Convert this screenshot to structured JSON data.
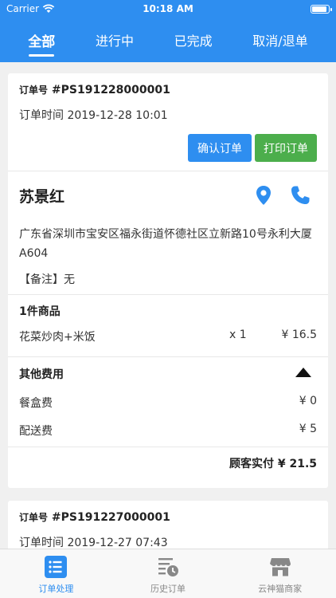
{
  "status_bar": {
    "carrier": "Carrier",
    "time": "10:18 AM",
    "battery_level": 0.95
  },
  "tabs": [
    {
      "label": "全部",
      "active": true
    },
    {
      "label": "进行中",
      "active": false
    },
    {
      "label": "已完成",
      "active": false
    },
    {
      "label": "取消/退单",
      "active": false
    }
  ],
  "orders": [
    {
      "order_no_label": "订单号",
      "order_no": "#PS191228000001",
      "time": "订单时间 2019-12-28 10:01",
      "confirm_label": "确认订单",
      "print_label": "打印订单",
      "customer_name": "苏景红",
      "address": "广东省深圳市宝安区福永街道怀德社区立新路10号永利大厦A604",
      "remark": "【备注】无",
      "goods_title": "1件商品",
      "goods": [
        {
          "name": "花菜炒肉+米饭",
          "qty": "x 1",
          "price": "¥ 16.5"
        }
      ],
      "fees_title": "其他费用",
      "fees": [
        {
          "name": "餐盒费",
          "amount": "¥ 0"
        },
        {
          "name": "配送费",
          "amount": "¥ 5"
        }
      ],
      "total": "顾客实付 ¥ 21.5"
    },
    {
      "order_no_label": "订单号",
      "order_no": "#PS191227000001",
      "time": "订单时间 2019-12-27 07:43"
    }
  ],
  "tabbar": [
    {
      "label": "订单处理",
      "icon": "list-icon",
      "active": true
    },
    {
      "label": "历史订单",
      "icon": "history-icon",
      "active": false
    },
    {
      "label": "云神猫商家",
      "icon": "store-icon",
      "active": false
    }
  ],
  "colors": {
    "primary": "#2e8ef0",
    "green": "#4cae4c"
  }
}
